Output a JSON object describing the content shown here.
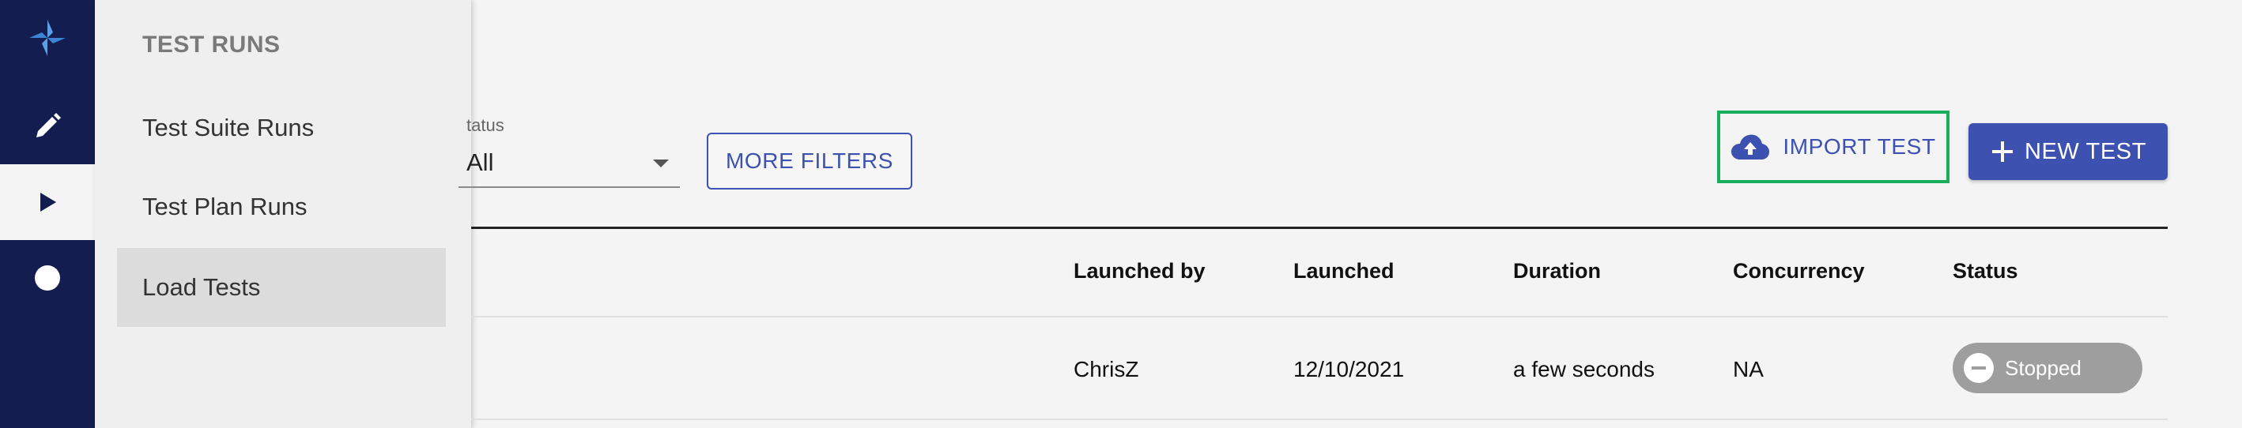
{
  "rail": {
    "logo_icon": "pinwheel-logo-icon",
    "items": [
      {
        "icon": "pencil-icon"
      },
      {
        "icon": "play-icon"
      },
      {
        "icon": "circle-icon"
      }
    ]
  },
  "flyout": {
    "title": "TEST RUNS",
    "items": [
      {
        "label": "Test Suite Runs"
      },
      {
        "label": "Test Plan Runs"
      },
      {
        "label": "Load Tests"
      }
    ]
  },
  "filters": {
    "status_label": "tatus",
    "status_value": "All",
    "more_filters_label": "MORE FILTERS"
  },
  "actions": {
    "import_label": "IMPORT TEST",
    "new_test_label": "NEW TEST"
  },
  "table": {
    "headers": {
      "launched_by": "Launched by",
      "launched": "Launched",
      "duration": "Duration",
      "concurrency": "Concurrency",
      "status": "Status"
    },
    "rows": [
      {
        "launched_by": "ChrisZ",
        "launched": "12/10/2021",
        "duration": "a few seconds",
        "concurrency": "NA",
        "status": "Stopped"
      }
    ]
  },
  "colors": {
    "rail": "#131d4f",
    "accent": "#3d51b0",
    "highlight": "#1aaf5d",
    "stopped_badge": "#9e9e9e"
  }
}
